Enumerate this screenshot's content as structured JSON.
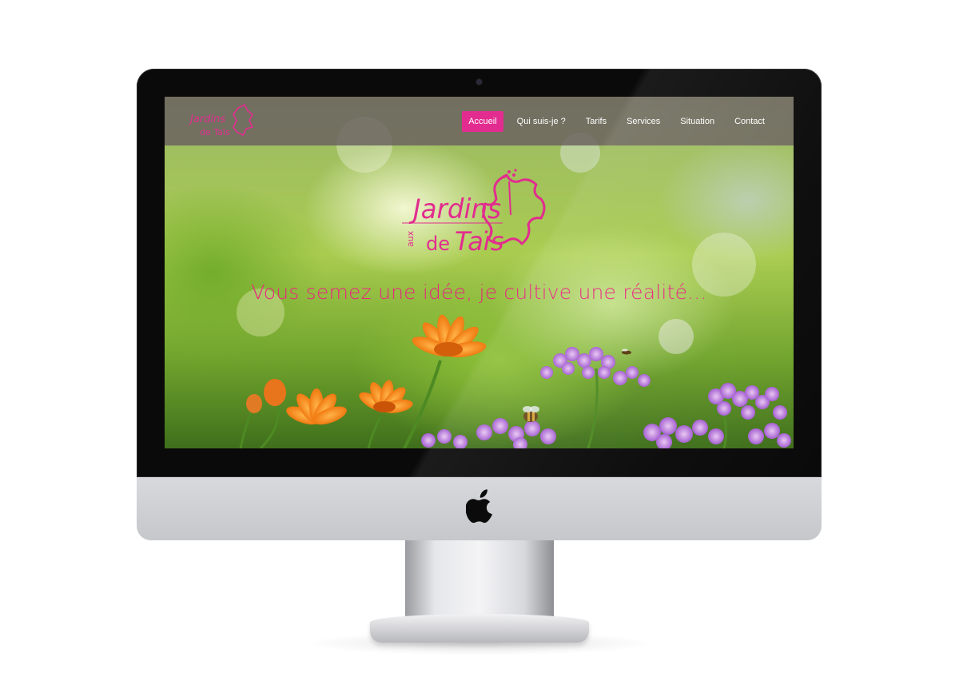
{
  "site": {
    "logo_text_main": "Jardins",
    "logo_text_aux": "aux",
    "logo_text_de": "de",
    "logo_text_name": "Taïs",
    "logo_color": "#e22c8f"
  },
  "nav": {
    "items": [
      {
        "label": "Accueil",
        "active": true
      },
      {
        "label": "Qui suis-je ?",
        "active": false
      },
      {
        "label": "Tarifs",
        "active": false
      },
      {
        "label": "Services",
        "active": false
      },
      {
        "label": "Situation",
        "active": false
      },
      {
        "label": "Contact",
        "active": false
      }
    ],
    "active_color": "#e22c8f"
  },
  "hero": {
    "tagline": "Vous semez une idée, je cultive une réalité..."
  },
  "device": {
    "logo_icon": "apple-icon"
  }
}
